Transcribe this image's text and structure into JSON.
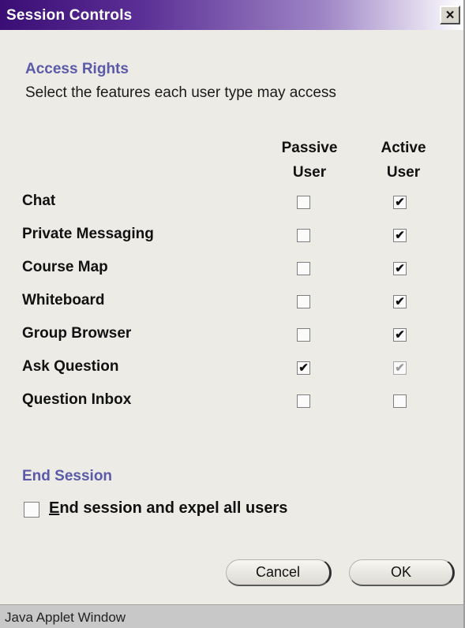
{
  "window": {
    "title": "Session Controls",
    "close_glyph": "×",
    "status": "Java Applet Window"
  },
  "access_rights": {
    "heading": "Access Rights",
    "subtitle": "Select the features each user type may access",
    "columns": {
      "passive_line1": "Passive",
      "passive_line2": "User",
      "active_line1": "Active",
      "active_line2": "User"
    },
    "rows": [
      {
        "label": "Chat",
        "passive": false,
        "active": true,
        "active_disabled": false
      },
      {
        "label": "Private Messaging",
        "passive": false,
        "active": true,
        "active_disabled": false
      },
      {
        "label": "Course Map",
        "passive": false,
        "active": true,
        "active_disabled": false
      },
      {
        "label": "Whiteboard",
        "passive": false,
        "active": true,
        "active_disabled": false
      },
      {
        "label": "Group Browser",
        "passive": false,
        "active": true,
        "active_disabled": false
      },
      {
        "label": "Ask Question",
        "passive": true,
        "active": true,
        "active_disabled": true
      },
      {
        "label": "Question Inbox",
        "passive": false,
        "active": false,
        "active_disabled": false
      }
    ]
  },
  "end_session": {
    "heading": "End Session",
    "checkbox_label": "End session and expel all users",
    "checked": false
  },
  "buttons": {
    "cancel": "Cancel",
    "ok": "OK"
  },
  "icons": {
    "close": "close-icon",
    "check": "checkmark-icon"
  }
}
